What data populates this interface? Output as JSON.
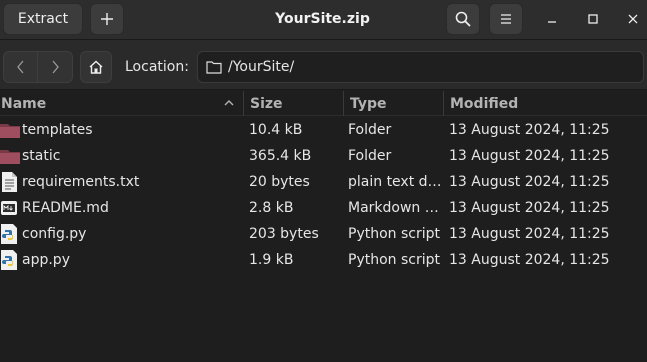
{
  "header": {
    "title": "YourSite.zip",
    "extract_label": "Extract",
    "add_icon": "plus-icon",
    "search_icon": "search-icon",
    "menu_icon": "hamburger-menu-icon",
    "window_controls": [
      "minimize-icon",
      "maximize-icon",
      "close-icon"
    ]
  },
  "location": {
    "label": "Location:",
    "path": "/YourSite/",
    "back_icon": "chevron-left-icon",
    "forward_icon": "chevron-right-icon",
    "home_icon": "home-icon",
    "folder_icon": "folder-outline-icon"
  },
  "columns": {
    "name": "Name",
    "size": "Size",
    "type": "Type",
    "modified": "Modified",
    "sort": "ascending"
  },
  "files": [
    {
      "name": "templates",
      "size": "10.4 kB",
      "type": "Folder",
      "modified": "13 August 2024, 11:25",
      "icon": "folder-icon"
    },
    {
      "name": "static",
      "size": "365.4 kB",
      "type": "Folder",
      "modified": "13 August 2024, 11:25",
      "icon": "folder-icon"
    },
    {
      "name": "requirements.txt",
      "size": "20 bytes",
      "type": "plain text d…",
      "modified": "13 August 2024, 11:25",
      "icon": "text-file-icon"
    },
    {
      "name": "README.md",
      "size": "2.8 kB",
      "type": "Markdown …",
      "modified": "13 August 2024, 11:25",
      "icon": "markdown-file-icon"
    },
    {
      "name": "config.py",
      "size": "203 bytes",
      "type": "Python script",
      "modified": "13 August 2024, 11:25",
      "icon": "python-file-icon"
    },
    {
      "name": "app.py",
      "size": "1.9 kB",
      "type": "Python script",
      "modified": "13 August 2024, 11:25",
      "icon": "python-file-icon"
    }
  ],
  "colors": {
    "background": "#1e1e1e",
    "headerbar": "#2d2d2d",
    "folder": "#9e4e5e",
    "text": "#e6e6e6"
  }
}
